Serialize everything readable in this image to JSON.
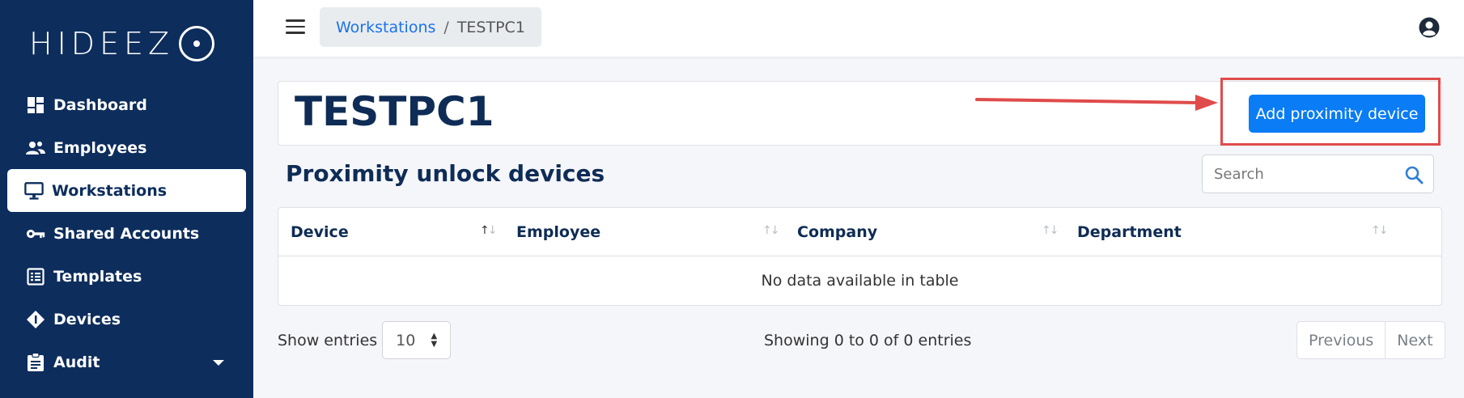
{
  "brand": {
    "logo_text": "HIDEEZ"
  },
  "sidebar": {
    "items": [
      {
        "label": "Dashboard",
        "icon": "dashboard-icon"
      },
      {
        "label": "Employees",
        "icon": "users-icon"
      },
      {
        "label": "Workstations",
        "icon": "monitor-icon",
        "active": true
      },
      {
        "label": "Shared Accounts",
        "icon": "key-icon"
      },
      {
        "label": "Templates",
        "icon": "list-icon"
      },
      {
        "label": "Devices",
        "icon": "diamond-icon"
      },
      {
        "label": "Audit",
        "icon": "clipboard-icon",
        "has_dropdown": true
      }
    ]
  },
  "topbar": {
    "breadcrumb": {
      "parent": "Workstations",
      "separator": "/",
      "current": "TESTPC1"
    }
  },
  "header": {
    "title": "TESTPC1",
    "add_button_label": "Add proximity device"
  },
  "section": {
    "title": "Proximity unlock devices",
    "search_placeholder": "Search"
  },
  "table": {
    "columns": [
      "Device",
      "Employee",
      "Company",
      "Department"
    ],
    "empty_message": "No data available in table"
  },
  "footer": {
    "show_entries_label": "Show entries",
    "entries_value": "10",
    "info": "Showing 0 to 0 of 0 entries",
    "previous_label": "Previous",
    "next_label": "Next"
  },
  "colors": {
    "sidebar_bg": "#0d2d5c",
    "primary_button": "#0a7cf5",
    "annotation_red": "#e04b4b",
    "link_blue": "#1a73e8"
  }
}
